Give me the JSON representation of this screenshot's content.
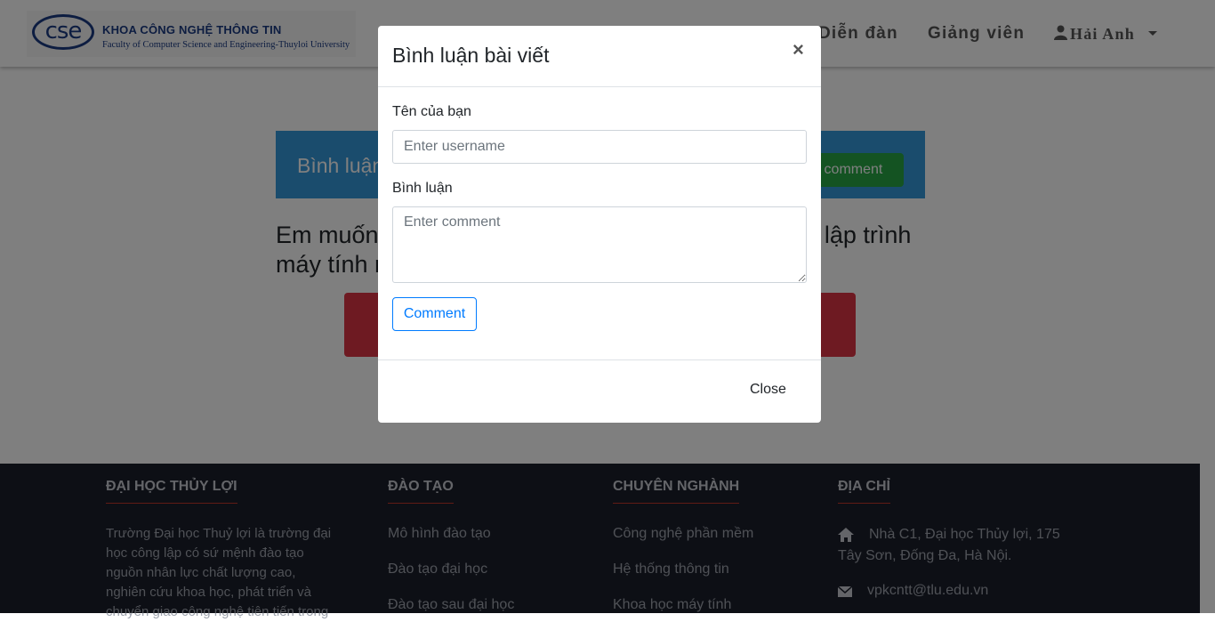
{
  "header": {
    "logo_mark": "cse",
    "logo_title": "KHOA CÔNG NGHỆ THÔNG TIN",
    "logo_subtitle": "Faculty of Computer Science and Engineering-Thuyloi University",
    "nav": {
      "forum": "Diễn đàn",
      "lecturers": "Giảng viên",
      "user": "Hải Anh"
    }
  },
  "main": {
    "banner_title": "Bình luận",
    "add_comment_label": "Add comment",
    "question_text": "Em muốn hỏi nên mua máy tính xách tay dùng cho lập trình máy tính nào ạ?"
  },
  "footer": {
    "columns": [
      {
        "heading": "ĐẠI HỌC THỦY LỢI",
        "text": "Trường Đại học Thuỷ lợi là trường đại học công lập có sứ mệnh đào tạo nguồn nhân lực chất lượng cao, nghiên cứu khoa học, phát triển và chuyển giao công nghệ tiên tiến trong"
      },
      {
        "heading": "ĐÀO TẠO",
        "links": [
          "Mô hình đào tạo",
          "Đào tạo đại học",
          "Đào tạo sau đại học"
        ]
      },
      {
        "heading": "CHUYÊN NGHÀNH",
        "links": [
          "Công nghệ phần mềm",
          "Hệ thống thông tin",
          "Khoa học máy tính"
        ]
      },
      {
        "heading": "ĐỊA CHỈ",
        "address": "Nhà C1, Đại học Thủy lợi, 175 Tây Sơn, Đống Đa, Hà Nội.",
        "email": "vpkcntt@tlu.edu.vn"
      }
    ]
  },
  "modal": {
    "title": "Bình luận bài viết",
    "close_x": "×",
    "name_label": "Tên của bạn",
    "name_placeholder": "Enter username",
    "comment_label": "Bình luận",
    "comment_placeholder": "Enter comment",
    "submit_label": "Comment",
    "close_label": "Close"
  },
  "icons": {
    "user": "user-icon",
    "home": "home-icon",
    "email": "envelope-icon"
  },
  "colors": {
    "banner": "#3498db",
    "add_button": "#28a745",
    "red_block": "#dc3545",
    "footer_bg": "#1b1f2b",
    "primary": "#007bff"
  }
}
